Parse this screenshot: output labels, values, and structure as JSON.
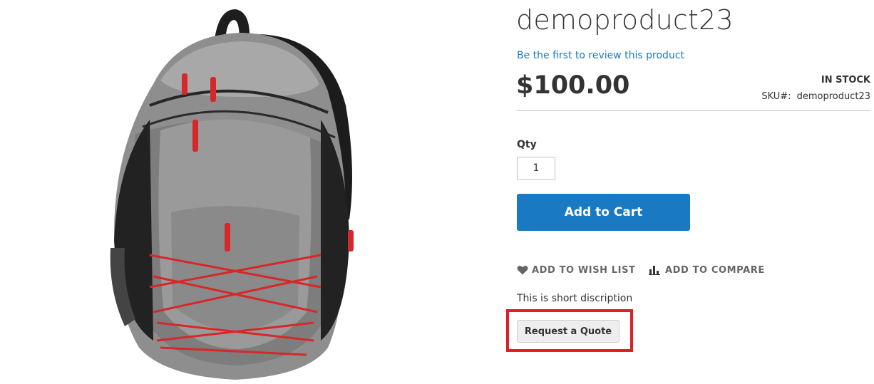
{
  "product": {
    "name": "demoproduct23",
    "review_link": "Be the first to review this product",
    "price": "$100.00",
    "stock_status": "IN STOCK",
    "sku_label": "SKU#:",
    "sku_value": "demoproduct23",
    "image_icon": "backpack-product-image"
  },
  "cart": {
    "qty_label": "Qty",
    "qty_value": "1",
    "add_to_cart_label": "Add to Cart"
  },
  "actions": {
    "wishlist_label": "ADD TO WISH LIST",
    "wishlist_icon": "heart-icon",
    "compare_label": "ADD TO COMPARE",
    "compare_icon": "bar-chart-icon"
  },
  "short_description": "This is short discription",
  "quote": {
    "button_label": "Request a Quote",
    "highlight_color": "#e11d25"
  },
  "colors": {
    "accent": "#1979c3",
    "text": "#333333",
    "link": "#1979c3"
  }
}
